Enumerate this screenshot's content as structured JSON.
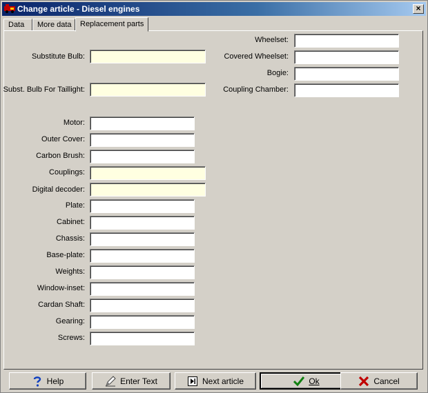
{
  "window": {
    "title": "Change article - Diesel engines",
    "close_label": "×"
  },
  "tabs": [
    {
      "label": "Data"
    },
    {
      "label": "More data"
    },
    {
      "label": "Replacement parts"
    }
  ],
  "left_fields": {
    "substitute_bulb": {
      "label": "Substitute Bulb:",
      "value": ""
    },
    "subst_bulb_taillight": {
      "label": "Subst. Bulb For Taillight:",
      "value": ""
    },
    "motor": {
      "label": "Motor:",
      "value": ""
    },
    "outer_cover": {
      "label": "Outer Cover:",
      "value": ""
    },
    "carbon_brush": {
      "label": "Carbon Brush:",
      "value": ""
    },
    "couplings": {
      "label": "Couplings:",
      "value": ""
    },
    "digital_decoder": {
      "label": "Digital decoder:",
      "value": ""
    },
    "plate": {
      "label": "Plate:",
      "value": ""
    },
    "cabinet": {
      "label": "Cabinet:",
      "value": ""
    },
    "chassis": {
      "label": "Chassis:",
      "value": ""
    },
    "base_plate": {
      "label": "Base-plate:",
      "value": ""
    },
    "weights": {
      "label": "Weights:",
      "value": ""
    },
    "window_inset": {
      "label": "Window-inset:",
      "value": ""
    },
    "cardan_shaft": {
      "label": "Cardan Shaft:",
      "value": ""
    },
    "gearing": {
      "label": "Gearing:",
      "value": ""
    },
    "screws": {
      "label": "Screws:",
      "value": ""
    }
  },
  "right_fields": {
    "wheelset": {
      "label": "Wheelset:",
      "value": ""
    },
    "covered_wheelset": {
      "label": "Covered Wheelset:",
      "value": ""
    },
    "bogie": {
      "label": "Bogie:",
      "value": ""
    },
    "coupling_chamber": {
      "label": "Coupling Chamber:",
      "value": ""
    }
  },
  "buttons": {
    "help": "Help",
    "enter_text": "Enter Text",
    "next_article": "Next article",
    "ok": "Ok",
    "cancel": "Cancel"
  },
  "colors": {
    "title_bar": "#0a246a",
    "window_bg": "#d4d0c8",
    "highlight_field": "#ffffe1"
  },
  "icons": {
    "app": "locomotive-icon",
    "help": "question-mark-icon",
    "enter_text": "pen-icon",
    "next_article": "next-record-icon",
    "ok": "checkmark-icon",
    "cancel": "x-cross-icon"
  }
}
